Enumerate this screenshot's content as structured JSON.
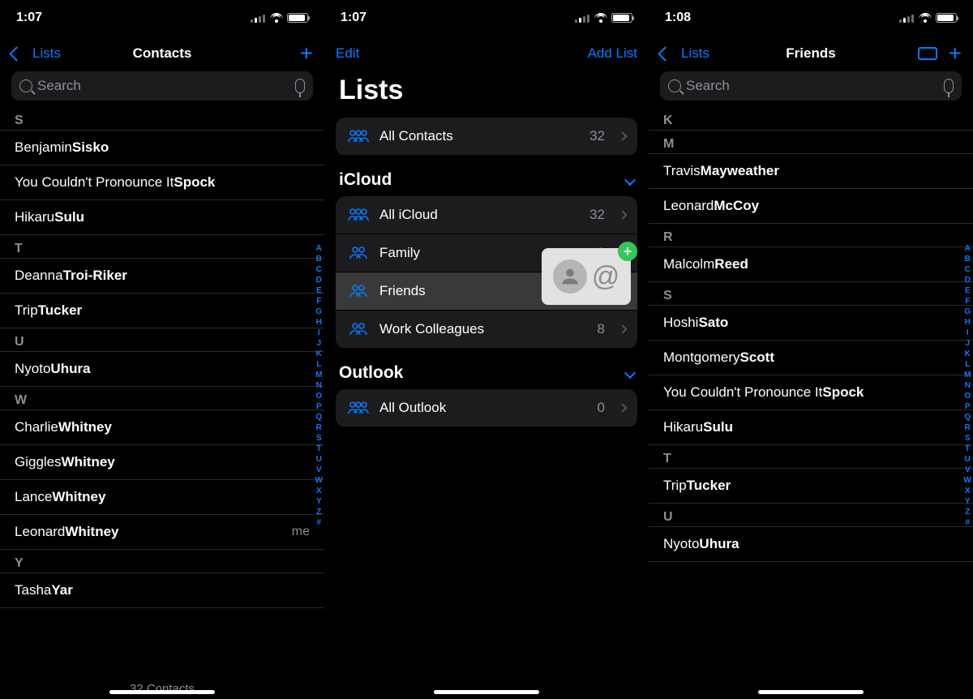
{
  "index_letters": [
    "A",
    "B",
    "C",
    "D",
    "E",
    "F",
    "G",
    "H",
    "I",
    "J",
    "K",
    "L",
    "M",
    "N",
    "O",
    "P",
    "Q",
    "R",
    "S",
    "T",
    "U",
    "V",
    "W",
    "X",
    "Y",
    "Z",
    "#"
  ],
  "screen1": {
    "time": "1:07",
    "back": "Lists",
    "title": "Contacts",
    "search": "Search",
    "footer": "32 Contacts",
    "me": "me",
    "sections": [
      {
        "letter": "S",
        "rows": [
          [
            "Benjamin",
            "Sisko"
          ],
          [
            "You Couldn't Pronounce It",
            "Spock"
          ],
          [
            "Hikaru",
            "Sulu"
          ]
        ]
      },
      {
        "letter": "T",
        "rows": [
          [
            "Deanna",
            "Troi-Riker"
          ],
          [
            "Trip",
            "Tucker"
          ]
        ]
      },
      {
        "letter": "U",
        "rows": [
          [
            "Nyoto",
            "Uhura"
          ]
        ]
      },
      {
        "letter": "W",
        "rows": [
          [
            "Charlie",
            "Whitney"
          ],
          [
            "Giggles",
            "Whitney"
          ],
          [
            "Lance",
            "Whitney"
          ],
          [
            "Leonard",
            "Whitney",
            "me"
          ]
        ]
      },
      {
        "letter": "Y",
        "rows": [
          [
            "Tasha",
            "Yar"
          ]
        ]
      }
    ]
  },
  "screen2": {
    "time": "1:07",
    "edit": "Edit",
    "add": "Add List",
    "title": "Lists",
    "all": {
      "name": "All Contacts",
      "count": 32
    },
    "accounts": [
      {
        "name": "iCloud",
        "lists": [
          {
            "name": "All iCloud",
            "count": 32,
            "triple": true
          },
          {
            "name": "Family",
            "count": 2
          },
          {
            "name": "Friends",
            "count": "",
            "sel": true
          },
          {
            "name": "Work Colleagues",
            "count": 8
          }
        ]
      },
      {
        "name": "Outlook",
        "lists": [
          {
            "name": "All Outlook",
            "count": 0,
            "triple": true
          }
        ]
      }
    ],
    "drag": {
      "at": "@",
      "plus": "+"
    }
  },
  "screen3": {
    "time": "1:08",
    "back": "Lists",
    "title": "Friends",
    "search": "Search",
    "sections": [
      {
        "letter": "K",
        "rows": []
      },
      {
        "letter": "M",
        "rows": [
          [
            "Travis",
            "Mayweather"
          ],
          [
            "Leonard",
            "McCoy"
          ]
        ]
      },
      {
        "letter": "R",
        "rows": [
          [
            "Malcolm",
            "Reed"
          ]
        ]
      },
      {
        "letter": "S",
        "rows": [
          [
            "Hoshi",
            "Sato"
          ],
          [
            "Montgomery",
            "Scott"
          ],
          [
            "You Couldn't Pronounce It",
            "Spock"
          ],
          [
            "Hikaru",
            "Sulu"
          ]
        ]
      },
      {
        "letter": "T",
        "rows": [
          [
            "Trip",
            "Tucker"
          ]
        ]
      },
      {
        "letter": "U",
        "rows": [
          [
            "Nyoto",
            "Uhura"
          ]
        ]
      }
    ]
  }
}
